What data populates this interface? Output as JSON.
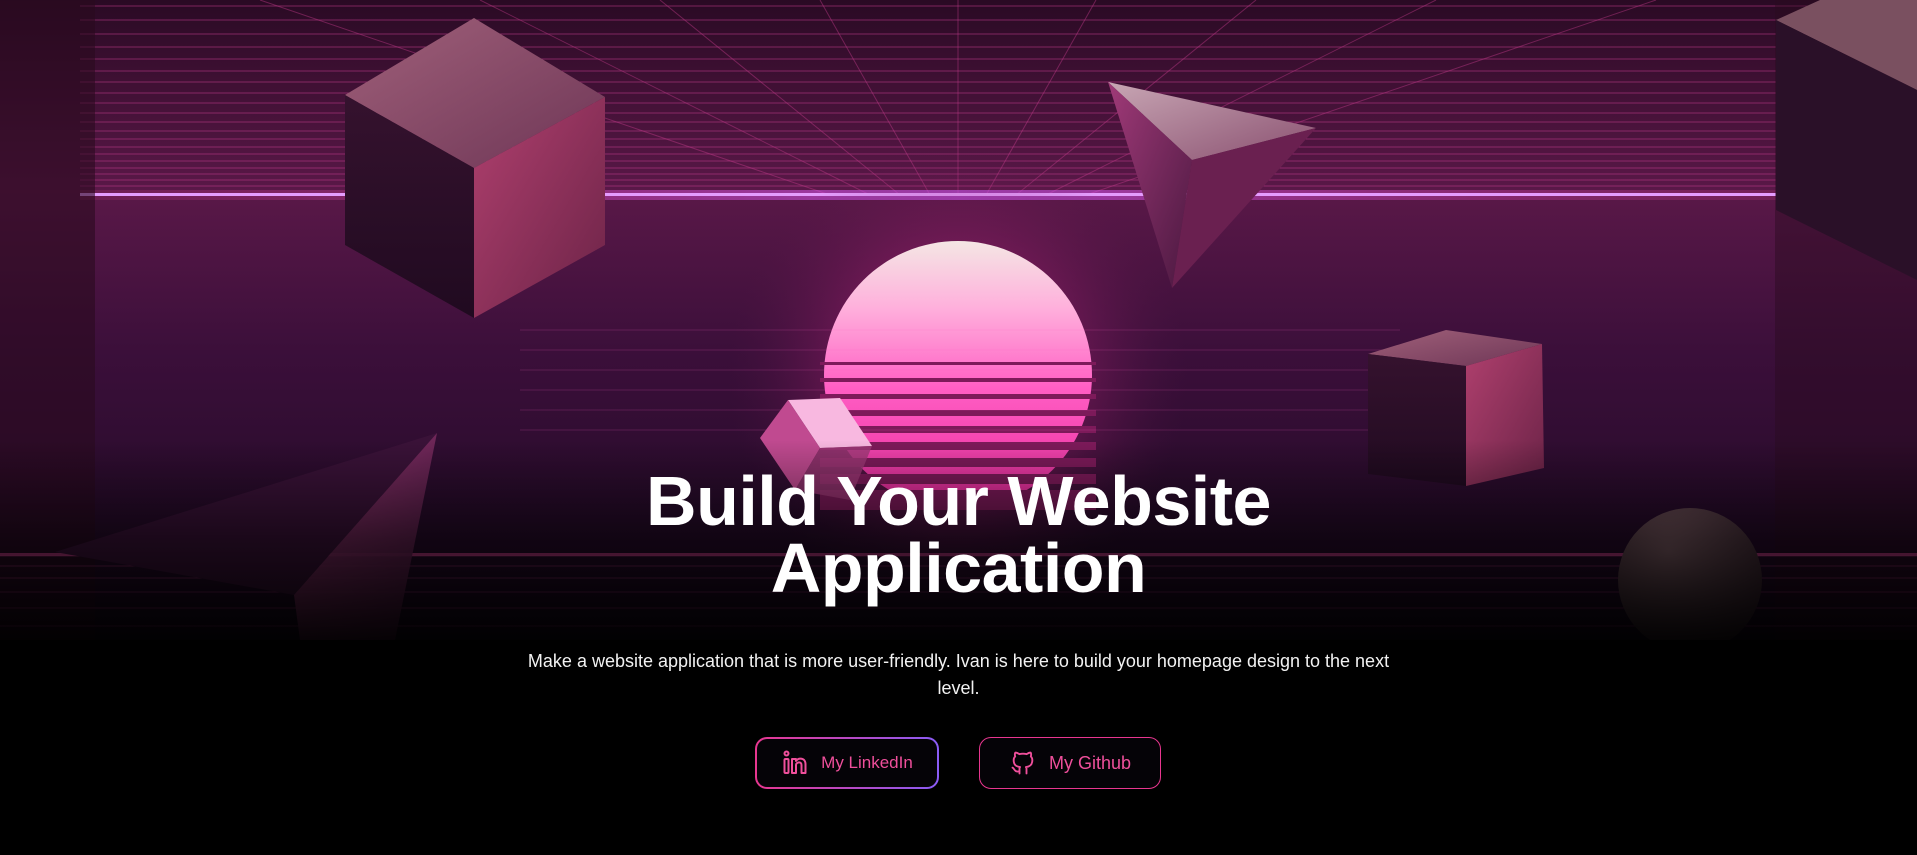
{
  "hero": {
    "title_line1": "Build Your Website",
    "title_line2": "Application",
    "subtitle": "Make a website application that is more user-friendly. Ivan is here to build your homepage design to the next level."
  },
  "buttons": {
    "linkedin": {
      "label": "My LinkedIn",
      "icon": "linkedin-icon"
    },
    "github": {
      "label": "My Github",
      "icon": "github-icon"
    }
  },
  "colors": {
    "background": "#000000",
    "accent_pink": "#e8368f",
    "accent_purple": "#8a5cf6",
    "button_text": "#ef4f9b",
    "sun_pink": "#ff5ec4"
  }
}
